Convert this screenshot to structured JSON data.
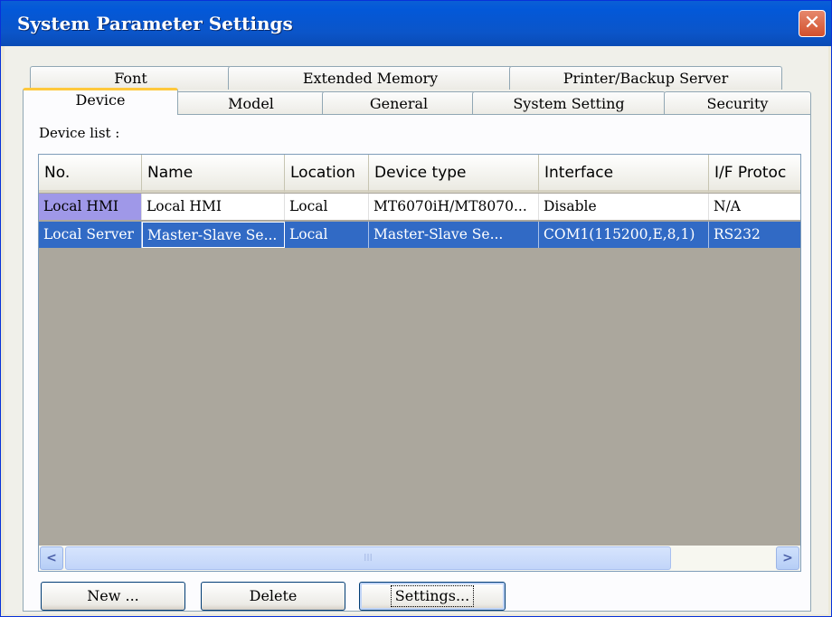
{
  "window": {
    "title": "System Parameter Settings",
    "close_glyph": "✕"
  },
  "tabs": {
    "row1": [
      "Font",
      "Extended Memory",
      "Printer/Backup Server"
    ],
    "row2": [
      "Device",
      "Model",
      "General",
      "System Setting",
      "Security"
    ],
    "active": "Device"
  },
  "device_list": {
    "label": "Device list :",
    "columns": [
      "No.",
      "Name",
      "Location",
      "Device type",
      "Interface",
      "I/F Protoc"
    ],
    "rows": [
      [
        "Local HMI",
        "Local HMI",
        "Local",
        "MT6070iH/MT8070...",
        "Disable",
        "N/A"
      ],
      [
        "Local Server",
        "Master-Slave Se...",
        "Local",
        "Master-Slave Se...",
        "COM1(115200,E,8,1)",
        "RS232"
      ]
    ],
    "selected_row": 1
  },
  "scrollbar": {
    "left_arrow": "<",
    "right_arrow": ">",
    "grip": "III"
  },
  "buttons": {
    "new": "New ...",
    "delete": "Delete",
    "settings": "Settings..."
  }
}
